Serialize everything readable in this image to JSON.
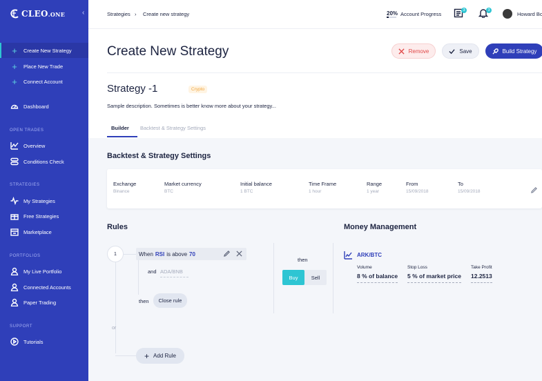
{
  "sidebar": {
    "logo_text": "CLEO",
    "logo_suffix": ".ONE",
    "collapse_icon": "‹",
    "actions": [
      {
        "label": "Create New Strategy"
      },
      {
        "label": "Place New Trade"
      },
      {
        "label": "Connect Account"
      }
    ],
    "dashboard_label": "Dashboard",
    "sections": {
      "open_trades": "OPEN TRADES",
      "strategies": "STRATEGIES",
      "portfolios": "PORTFOLIOS",
      "support": "SUPPORT"
    },
    "open_trades_items": [
      {
        "label": "Overview",
        "icon": "chart-icon"
      },
      {
        "label": "Conditions Check",
        "icon": "toggle-icon"
      }
    ],
    "strategies_items": [
      {
        "label": "My Strategies",
        "icon": "pulse-icon"
      },
      {
        "label": "Free Strategies",
        "icon": "gift-icon"
      },
      {
        "label": "Marketplace",
        "icon": "store-icon"
      }
    ],
    "portfolios_items": [
      {
        "label": "My Live Portfolio",
        "icon": "user-icon"
      },
      {
        "label": "Connected Accounts",
        "icon": "user-icon"
      },
      {
        "label": "Paper Trading",
        "icon": "user-icon"
      }
    ],
    "support_items": [
      {
        "label": "Tutorials",
        "icon": "play-icon"
      }
    ]
  },
  "topbar": {
    "breadcrumb": [
      "Strategies",
      "Create new strategy"
    ],
    "breadcrumb_sep": "›",
    "progress_value": "20%",
    "progress_fraction": 0.2,
    "progress_label": "Account Progress",
    "doc_badge": "3",
    "bell_badge": "3",
    "user_name": "Howard Bo"
  },
  "header": {
    "title": "Create New Strategy",
    "remove_label": "Remove",
    "save_label": "Save",
    "build_label": "Build Strategy",
    "strategy_name": "Strategy -1",
    "tag": "Crypto",
    "description": "Sample description. Sometimes is better know more about your strategy...",
    "tabs": [
      "Builder",
      "Backtest & Strategy Settings"
    ]
  },
  "backtest": {
    "title": "Backtest & Strategy Settings",
    "fields": [
      {
        "label": "Exchange",
        "value": "Binance"
      },
      {
        "label": "Market currency",
        "value": "BTC"
      },
      {
        "label": "Initial balance",
        "value": "1 BTC"
      },
      {
        "label": "Time Frame",
        "value": "1 hour"
      },
      {
        "label": "Range",
        "value": "1 year"
      },
      {
        "label": "From",
        "value": "15/09/2018"
      },
      {
        "label": "To",
        "value": "15/09/2018"
      }
    ]
  },
  "rules": {
    "title": "Rules",
    "number": "1",
    "cond_when": "When",
    "cond_indicator": "RSI",
    "cond_op": "is above",
    "cond_value": "70",
    "and_label": "and",
    "and_value": "ADA/BNB",
    "then_label": "then",
    "close_rule": "Close rule",
    "or_label": "or",
    "add_rule": "Add Rule",
    "then2": "then",
    "buy": "Buy",
    "sell": "Sell"
  },
  "money": {
    "title": "Money Management",
    "pair": "ARK/BTC",
    "fields": [
      {
        "label": "Volume",
        "value": "8 % of balance"
      },
      {
        "label": "Stop Loss",
        "value": "5 % of market price"
      },
      {
        "label": "Take Profit",
        "value": "12.2513"
      }
    ]
  }
}
